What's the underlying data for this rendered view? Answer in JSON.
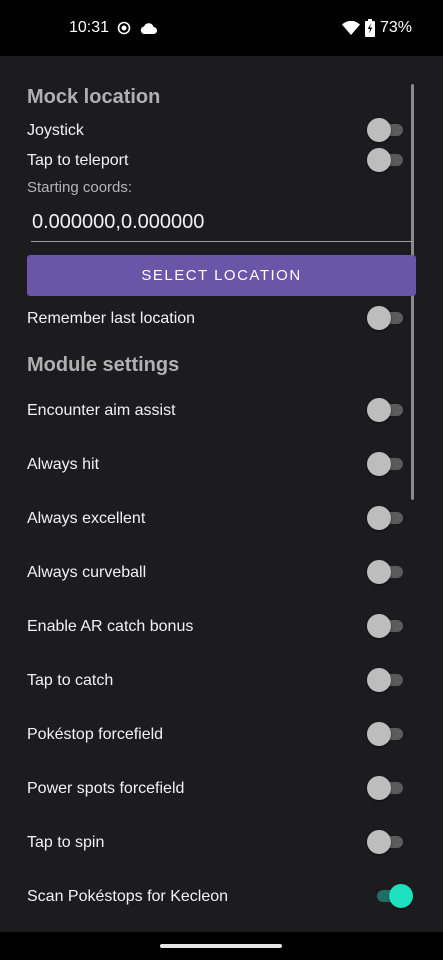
{
  "status_bar": {
    "time": "10:31",
    "battery_percent": "73%",
    "icons": [
      "screen-record-icon",
      "cloud-icon",
      "wifi-icon",
      "battery-charging-icon"
    ]
  },
  "mock_location": {
    "title": "Mock location",
    "joystick": {
      "label": "Joystick",
      "enabled": false
    },
    "tap_to_teleport": {
      "label": "Tap to teleport",
      "enabled": false
    },
    "starting_coords_label": "Starting coords:",
    "coords_value": "0.000000,0.000000",
    "select_location_label": "SELECT LOCATION",
    "remember_last_location": {
      "label": "Remember last location",
      "enabled": false
    }
  },
  "module_settings": {
    "title": "Module settings",
    "items": [
      {
        "label": "Encounter aim assist",
        "enabled": false
      },
      {
        "label": "Always hit",
        "enabled": false
      },
      {
        "label": "Always excellent",
        "enabled": false
      },
      {
        "label": "Always curveball",
        "enabled": false
      },
      {
        "label": "Enable AR catch bonus",
        "enabled": false
      },
      {
        "label": "Tap to catch",
        "enabled": false
      },
      {
        "label": "Pokéstop forcefield",
        "enabled": false
      },
      {
        "label": "Power spots forcefield",
        "enabled": false
      },
      {
        "label": "Tap to spin",
        "enabled": false
      },
      {
        "label": "Scan Pokéstops for Kecleon",
        "enabled": true
      }
    ]
  },
  "colors": {
    "background": "#1c1c1e",
    "accent_button": "#6a55a8",
    "toggle_on": "#1de0bf",
    "toggle_off": "#bdbdbd"
  }
}
